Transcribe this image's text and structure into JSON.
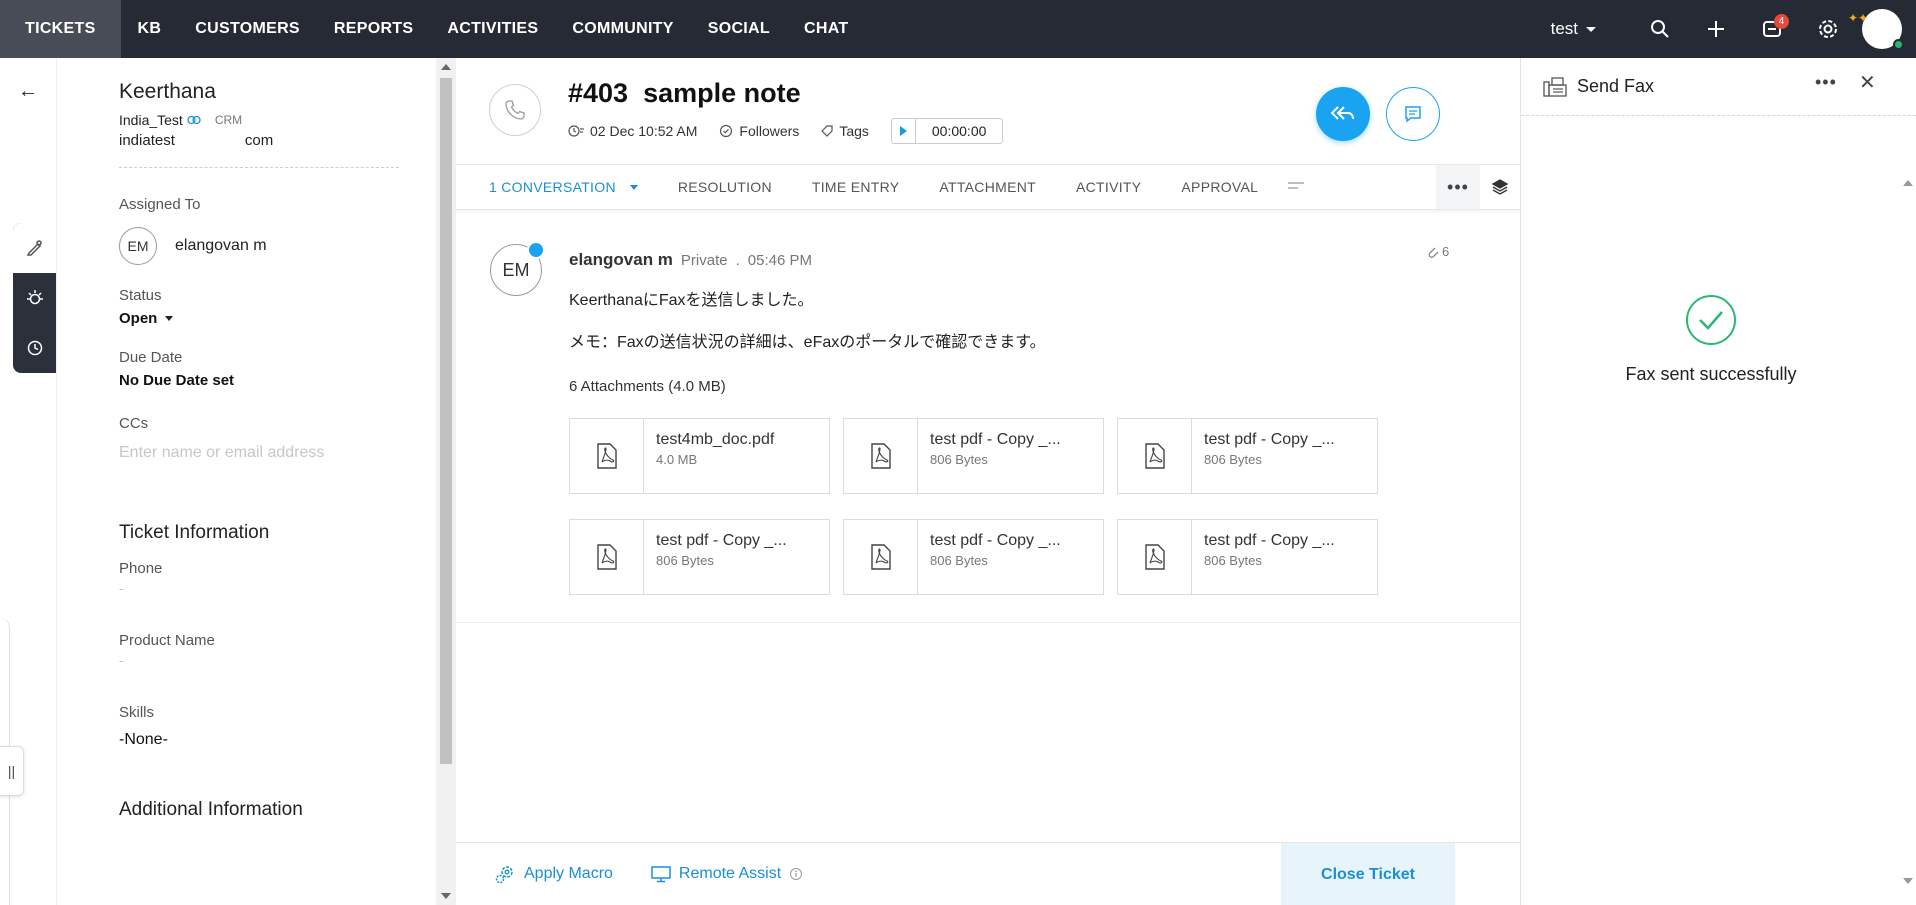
{
  "nav": {
    "tabs": [
      "TICKETS",
      "KB",
      "CUSTOMERS",
      "REPORTS",
      "ACTIVITIES",
      "COMMUNITY",
      "SOCIAL",
      "CHAT"
    ],
    "user": "test",
    "notification_count": "4"
  },
  "contact": {
    "name": "Keerthana",
    "account": "India_Test",
    "crm_label": "CRM",
    "email_start": "indiatest",
    "email_end": "com"
  },
  "left": {
    "assigned_label": "Assigned To",
    "assignee_initials": "EM",
    "assignee_name": "elangovan m",
    "status_label": "Status",
    "status_value": "Open",
    "due_label": "Due Date",
    "due_value": "No Due Date set",
    "ccs_label": "CCs",
    "ccs_placeholder": "Enter name or email address",
    "ticket_info_title": "Ticket Information",
    "phone_label": "Phone",
    "phone_value": "-",
    "product_label": "Product Name",
    "product_value": "-",
    "skills_label": "Skills",
    "skills_value": "-None-",
    "additional_title": "Additional Information"
  },
  "ticket": {
    "number": "#403",
    "subject": "sample note",
    "date": "02 Dec 10:52 AM",
    "followers": "Followers",
    "tags": "Tags",
    "timer": "00:00:00"
  },
  "tabs": {
    "conversation": "1  CONVERSATION",
    "resolution": "RESOLUTION",
    "time_entry": "TIME ENTRY",
    "attachment": "ATTACHMENT",
    "activity": "ACTIVITY",
    "approval": "APPROVAL"
  },
  "thread": {
    "initials": "EM",
    "author": "elangovan m",
    "visibility": "Private",
    "time": "05:46 PM",
    "attachment_count": "6",
    "line1": "KeerthanaにFaxを送信しました。",
    "line2": "メモ：Faxの送信状況の詳細は、eFaxのポータルで確認できます。",
    "attachments_title": "6  Attachments  (4.0 MB)",
    "attachments": [
      {
        "name": "test4mb_doc.pdf",
        "size": "4.0 MB"
      },
      {
        "name": "test pdf - Copy _...",
        "size": "806 Bytes"
      },
      {
        "name": "test pdf - Copy _...",
        "size": "806 Bytes"
      },
      {
        "name": "test pdf - Copy _...",
        "size": "806 Bytes"
      },
      {
        "name": "test pdf - Copy _...",
        "size": "806 Bytes"
      },
      {
        "name": "test pdf - Copy _...",
        "size": "806 Bytes"
      }
    ]
  },
  "bottom": {
    "apply_macro": "Apply Macro",
    "remote_assist": "Remote Assist",
    "close_ticket": "Close Ticket"
  },
  "fax": {
    "title": "Send Fax",
    "status": "Fax sent successfully"
  },
  "colors": {
    "accent": "#1aa3f0",
    "nav_bg": "#252a35",
    "success": "#2bb673"
  }
}
